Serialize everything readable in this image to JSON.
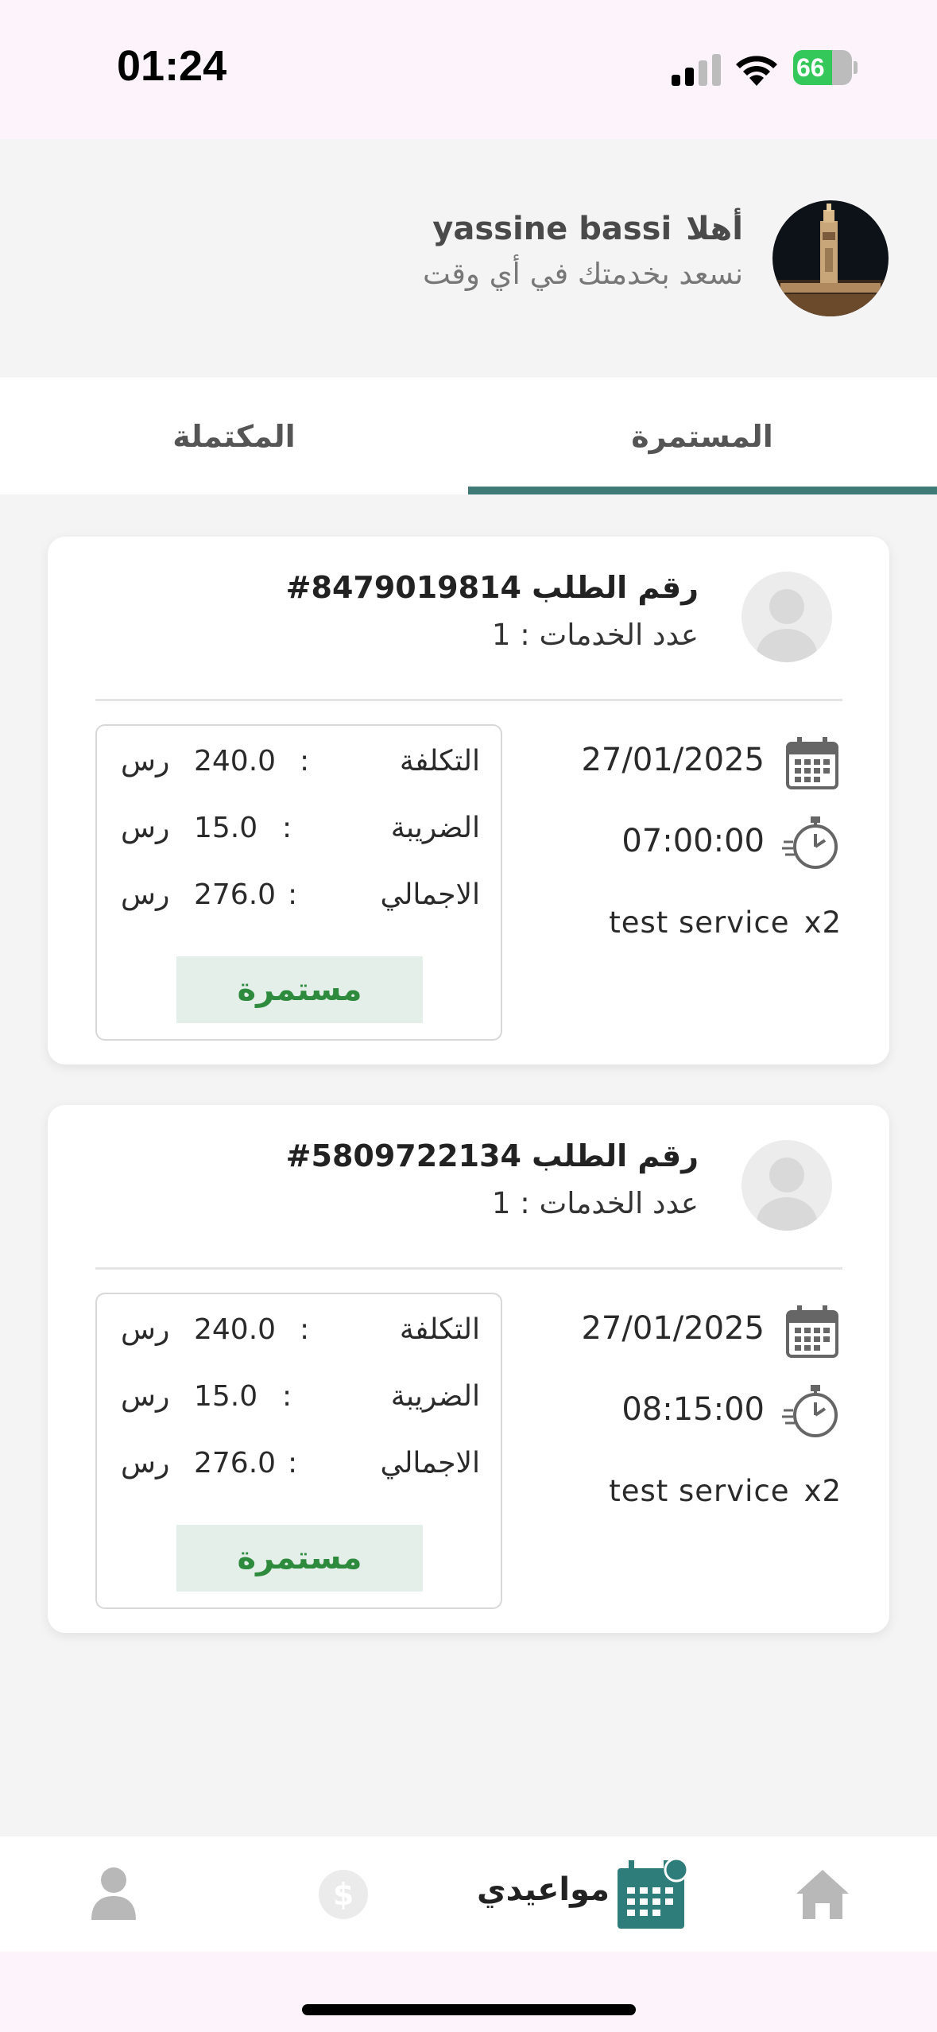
{
  "status_bar": {
    "time": "01:24",
    "battery_level": "66",
    "battery_fraction": 0.66,
    "icons": [
      "cellular-signal-icon",
      "wifi-icon",
      "battery-charging-icon"
    ]
  },
  "header": {
    "greeting_word": "أهلا",
    "user_name": "yassine bassi",
    "subtitle": "نسعد بخدمتك في أي وقت",
    "avatar": "tower-photo"
  },
  "tabs": [
    {
      "label": "المستمرة",
      "active": true
    },
    {
      "label": "المكتملة",
      "active": false
    }
  ],
  "orders": [
    {
      "order_label": "رقم الطلب",
      "order_number": "#8479019814",
      "services_label": "عدد الخدمات",
      "services_count": "1",
      "date": "27/01/2025",
      "time": "07:00:00",
      "service_name": "test service",
      "service_qty": "x2",
      "cost_label": "التكلفة",
      "cost_value": "240.0",
      "tax_label": "الضريبة",
      "tax_value": "15.0",
      "total_label": "الاجمالي",
      "total_value": "276.0",
      "currency": "رس",
      "status": "مستمرة"
    },
    {
      "order_label": "رقم الطلب",
      "order_number": "#5809722134",
      "services_label": "عدد الخدمات",
      "services_count": "1",
      "date": "27/01/2025",
      "time": "08:15:00",
      "service_name": "test service",
      "service_qty": "x2",
      "cost_label": "التكلفة",
      "cost_value": "240.0",
      "tax_label": "الضريبة",
      "tax_value": "15.0",
      "total_label": "الاجمالي",
      "total_value": "276.0",
      "currency": "رس",
      "status": "مستمرة"
    }
  ],
  "bottom_nav": {
    "items": [
      {
        "icon": "home-icon",
        "active": false
      },
      {
        "icon": "calendar-icon",
        "label": "مواعيدي",
        "active": true
      },
      {
        "icon": "dollar-icon",
        "active": false
      },
      {
        "icon": "person-icon",
        "active": false
      }
    ]
  },
  "colors": {
    "accent": "#3f7a76",
    "status_text": "#2e8b3e",
    "status_bg": "#e5efe9",
    "nav_active": "#2f7d7a"
  }
}
